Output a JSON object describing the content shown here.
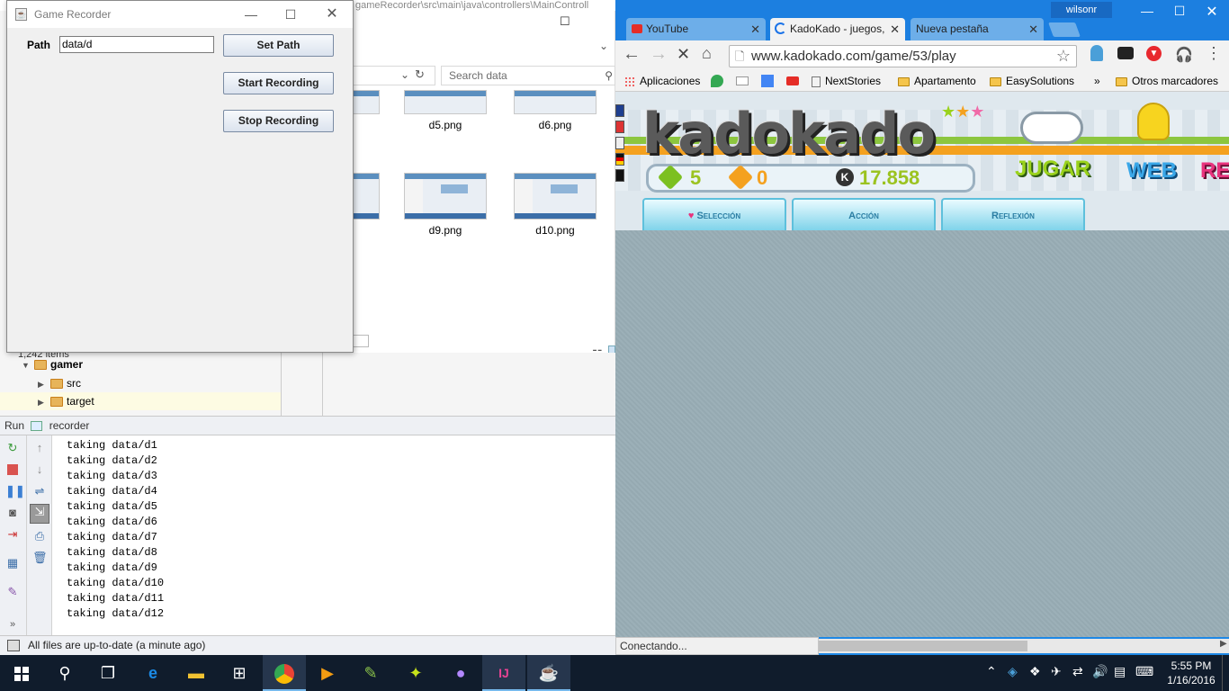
{
  "ide": {
    "title_fragment": "gameRecorder\\src\\main\\java\\controllers\\MainControll",
    "items_count": "1,242 items",
    "tree": [
      {
        "label": "gamer"
      },
      {
        "label": "src"
      },
      {
        "label": "target"
      }
    ],
    "run_label": "Run",
    "run_config": "recorder",
    "console_lines": [
      "taking data/d1",
      "taking data/d2",
      "taking data/d3",
      "taking data/d4",
      "taking data/d5",
      "taking data/d6",
      "taking data/d7",
      "taking data/d8",
      "taking data/d9",
      "taking data/d10",
      "taking data/d11",
      "taking data/d12"
    ],
    "status": "All files are up-to-date (a minute ago)"
  },
  "explorer": {
    "search_placeholder": "Search data",
    "files": [
      "d5.png",
      "d6.png",
      "d9.png",
      "d10.png"
    ],
    "partial_label": "g"
  },
  "recorder": {
    "title": "Game Recorder",
    "path_label": "Path",
    "path_value": "data/d",
    "set_path": "Set Path",
    "start": "Start Recording",
    "stop": "Stop Recording"
  },
  "chrome": {
    "profile": "wilsonr",
    "tabs": [
      {
        "title": "YouTube"
      },
      {
        "title": "KadoKado - juegos,"
      },
      {
        "title": "Nueva pestaña"
      }
    ],
    "url": "www.kadokado.com/game/53/play",
    "bookmarks": [
      "Aplicaciones",
      "NextStories",
      "Apartamento",
      "EasySolutions",
      "»",
      "Otros marcadores"
    ],
    "status": "Conectando..."
  },
  "kadokado": {
    "logo": "kadokado",
    "gems_green": "5",
    "gems_orange": "0",
    "kado_points": "17.858",
    "nav": [
      "JUGAR",
      "WEB",
      "RE"
    ],
    "categories": [
      "Selección",
      "Acción",
      "Reflexión"
    ]
  },
  "taskbar": {
    "time": "5:55 PM",
    "date": "1/16/2016"
  }
}
